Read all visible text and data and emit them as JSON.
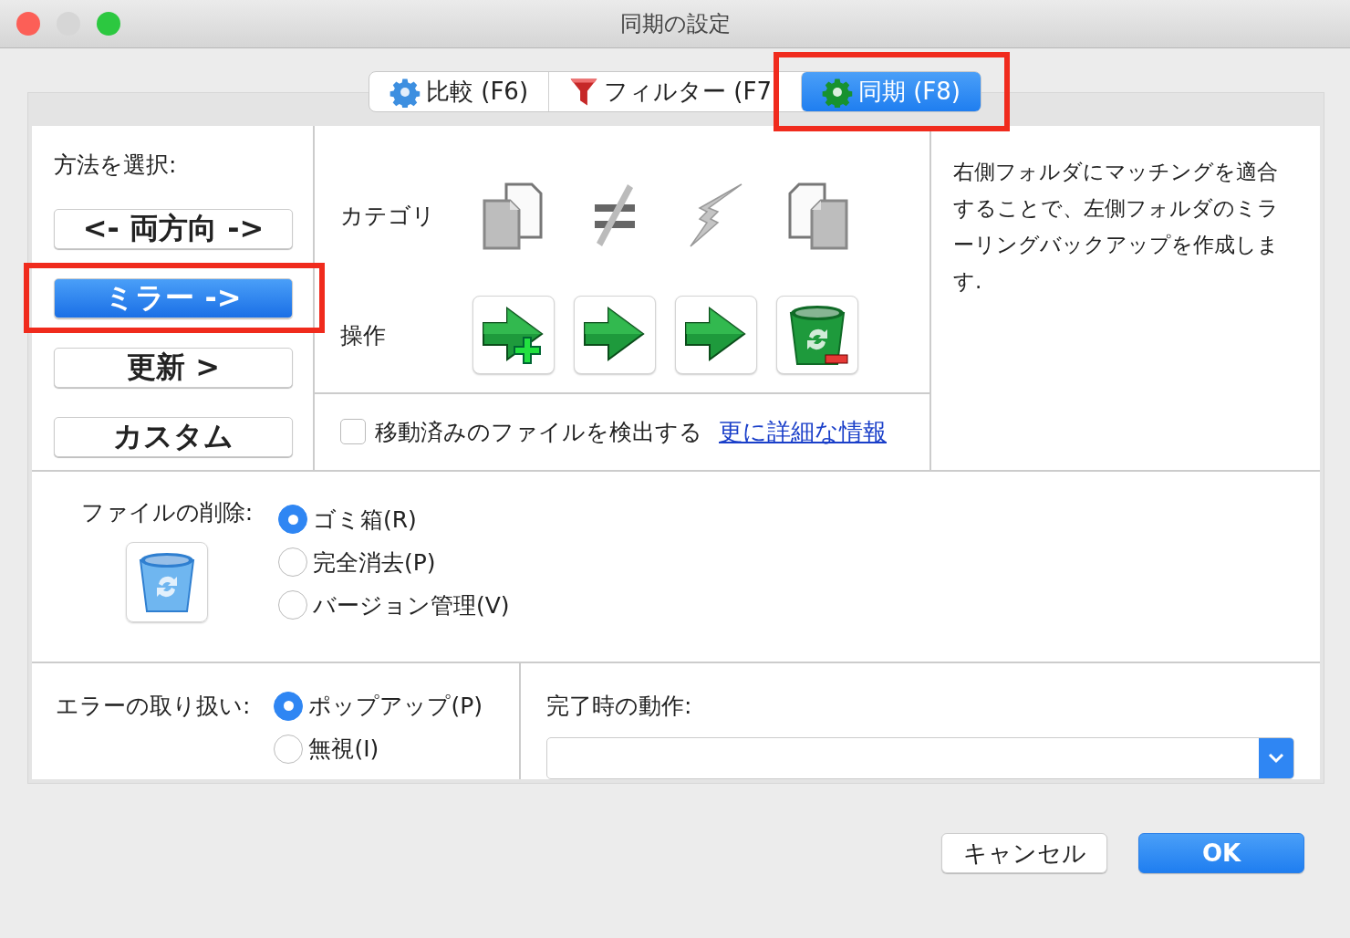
{
  "window": {
    "title": "同期の設定"
  },
  "tabs": [
    {
      "label": "比較 (F6)",
      "selected": false,
      "highlighted": false
    },
    {
      "label": "フィルター (F7",
      "selected": false,
      "highlighted": false
    },
    {
      "label": "同期 (F8)",
      "selected": true,
      "highlighted": true
    }
  ],
  "method": {
    "label": "方法を選択:",
    "options": [
      {
        "label": "<- 両方向 ->",
        "selected": false,
        "highlighted": false
      },
      {
        "label": "ミラー ->",
        "selected": true,
        "highlighted": true
      },
      {
        "label": "更新 >",
        "selected": false,
        "highlighted": false
      },
      {
        "label": "カスタム",
        "selected": false,
        "highlighted": false
      }
    ]
  },
  "grid": {
    "category_label": "カテゴリ",
    "action_label": "操作"
  },
  "detect_moved": {
    "label": "移動済みのファイルを検出する",
    "checked": false,
    "link": "更に詳細な情報"
  },
  "description": "右側フォルダにマッチングを適合することで、左側フォルダのミラーリングバックアップを作成します.",
  "deletion": {
    "label": "ファイルの削除:",
    "options": [
      {
        "label": "ゴミ箱(R)",
        "selected": true
      },
      {
        "label": "完全消去(P)",
        "selected": false
      },
      {
        "label": "バージョン管理(V)",
        "selected": false
      }
    ]
  },
  "errors": {
    "label": "エラーの取り扱い:",
    "options": [
      {
        "label": "ポップアップ(P)",
        "selected": true
      },
      {
        "label": "無視(I)",
        "selected": false
      }
    ]
  },
  "completion": {
    "label": "完了時の動作:"
  },
  "buttons": [
    {
      "label": "キャンセル",
      "kind": "default"
    },
    {
      "label": "OK",
      "kind": "primary"
    }
  ]
}
